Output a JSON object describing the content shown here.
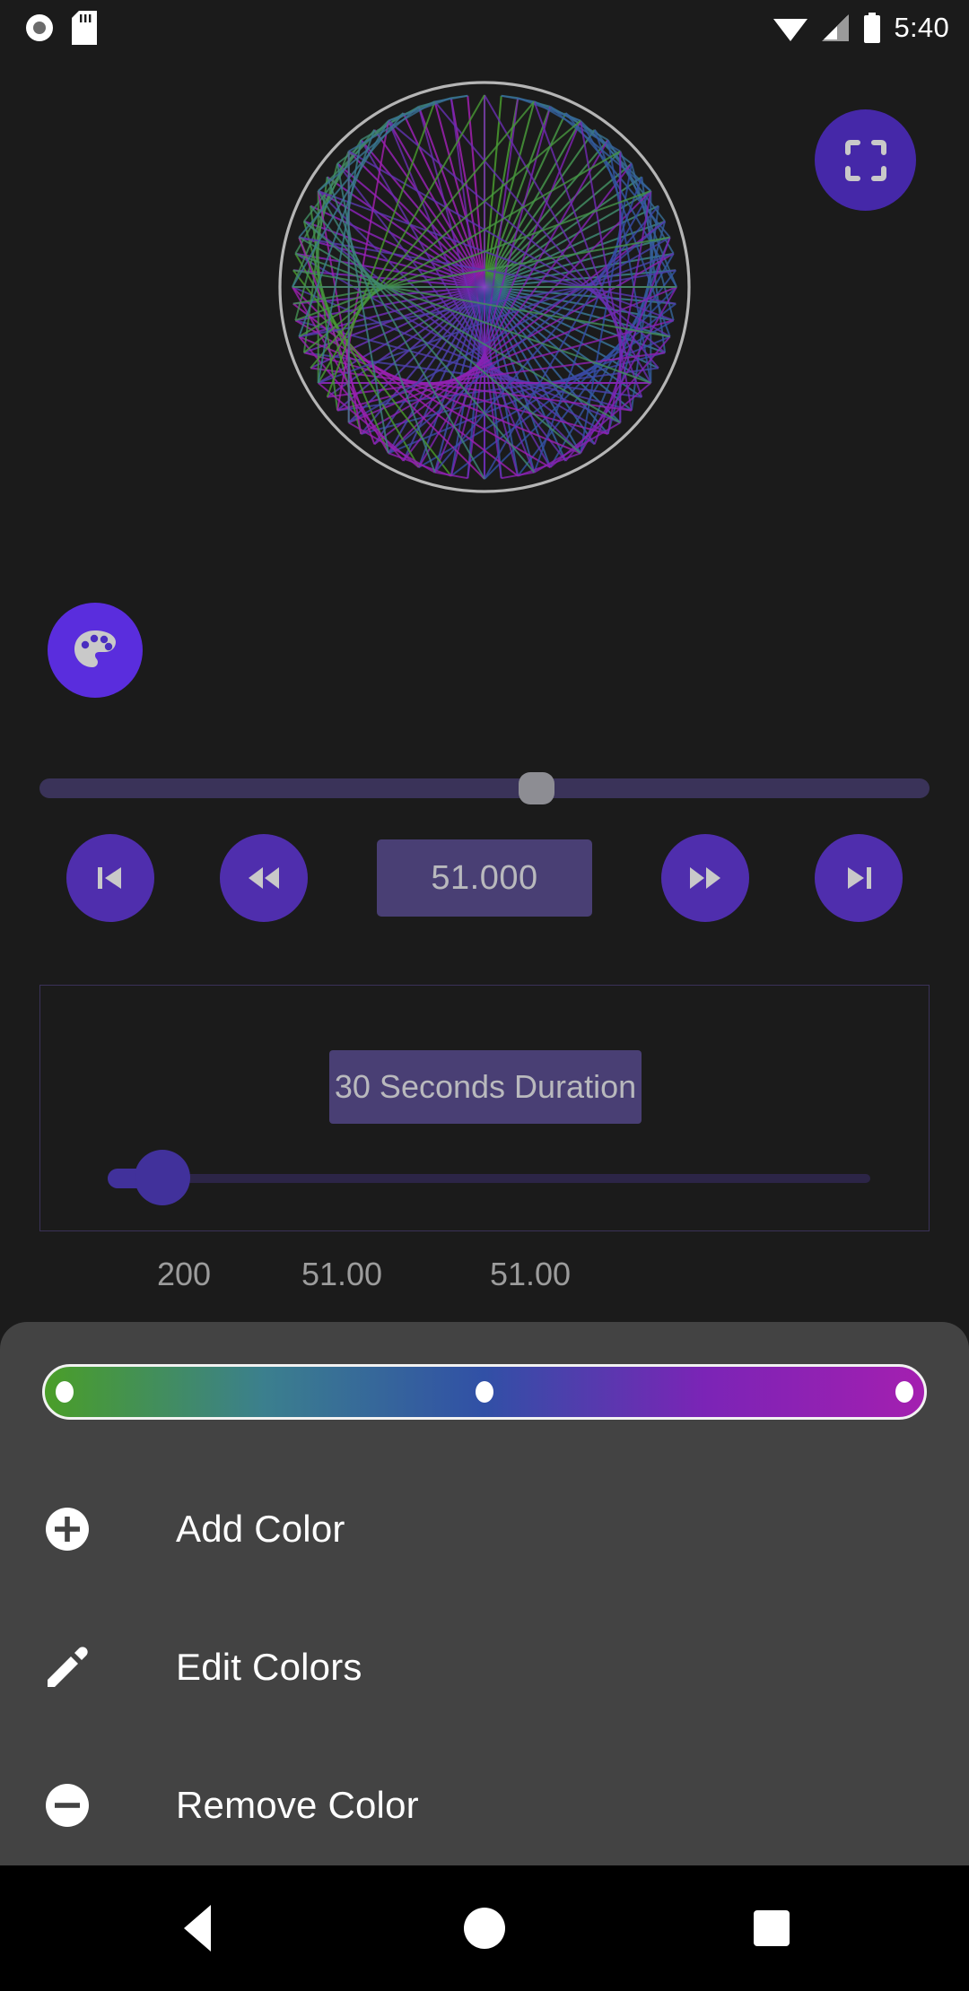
{
  "status_bar": {
    "time": "5:40",
    "left_icons": [
      "record-icon",
      "sd-card-icon"
    ],
    "right_icons": [
      "wifi-icon",
      "signal-icon",
      "battery-icon"
    ]
  },
  "canvas": {
    "name": "string-art-visualizer",
    "outline_color": "#b5b5b5",
    "background": "#1b1b1b"
  },
  "fabs": {
    "fullscreen": {
      "icon": "fullscreen-icon",
      "color": "#4528a8"
    },
    "palette": {
      "icon": "palette-icon",
      "color": "#5a2ddd"
    }
  },
  "seek_bar": {
    "name": "playback-seek-bar",
    "value_percent": 56,
    "track_color": "#3a3359",
    "thumb_color": "#8d8d93"
  },
  "transport": {
    "skip_previous": "skip-previous-icon",
    "rewind": "rewind-icon",
    "value": "51.000",
    "fast_forward": "fast-forward-icon",
    "skip_next": "skip-next-icon",
    "button_color": "#4f2ead",
    "value_bg": "#493f74"
  },
  "duration_panel": {
    "button_label": "30 Seconds Duration",
    "slider_percent": 6,
    "border_color": "#3a3258"
  },
  "values": {
    "points": "200",
    "value_a": "51.00",
    "value_b": "51.00"
  },
  "bottom_sheet": {
    "background": "#434343",
    "gradient": {
      "name": "color-gradient-bar",
      "stops": [
        {
          "position": 0,
          "color": "#4a9e28"
        },
        {
          "position": 25,
          "color": "#3b7f8e"
        },
        {
          "position": 50,
          "color": "#3150a6"
        },
        {
          "position": 75,
          "color": "#7b24b6"
        },
        {
          "position": 100,
          "color": "#a41fb0"
        }
      ],
      "handles": [
        0,
        50,
        100
      ]
    },
    "items": [
      {
        "icon": "add-circle-icon",
        "label": "Add Color"
      },
      {
        "icon": "pencil-icon",
        "label": "Edit Colors"
      },
      {
        "icon": "remove-circle-icon",
        "label": "Remove Color"
      }
    ]
  },
  "nav_bar": {
    "back": "back-triangle-icon",
    "home": "home-circle-icon",
    "recents": "recents-square-icon"
  }
}
